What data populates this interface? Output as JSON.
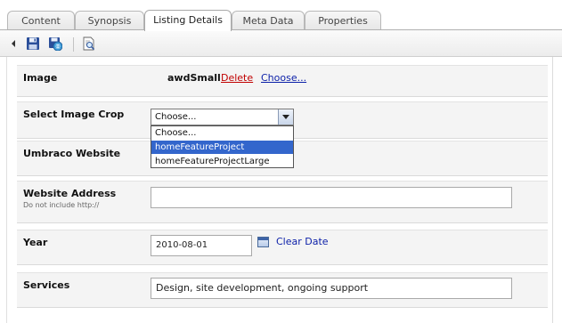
{
  "tabs": [
    {
      "label": "Content",
      "active": false
    },
    {
      "label": "Synopsis",
      "active": false
    },
    {
      "label": "Listing Details",
      "active": true
    },
    {
      "label": "Meta Data",
      "active": false
    },
    {
      "label": "Properties",
      "active": false
    }
  ],
  "toolbar": {
    "icons": [
      "collapse-arrow-icon",
      "save-icon",
      "save-publish-icon",
      "preview-icon"
    ]
  },
  "fields": {
    "image": {
      "label": "Image",
      "filename": "awdSmall",
      "delete_label": "Delete",
      "choose_label": "Choose..."
    },
    "crop": {
      "label": "Select Image Crop",
      "selected": "Choose...",
      "options": [
        "Choose...",
        "homeFeatureProject",
        "homeFeatureProjectLarge"
      ],
      "highlighted": "homeFeatureProject"
    },
    "website": {
      "label": "Umbraco Website"
    },
    "address": {
      "label": "Website Address",
      "hint": "Do not include http://",
      "value": ""
    },
    "year": {
      "label": "Year",
      "value": "2010-08-01",
      "clear_label": "Clear Date"
    },
    "services": {
      "label": "Services",
      "value": "Design, site development, ongoing support"
    }
  },
  "colors": {
    "link": "#0a1ea8",
    "delete": "#c00000",
    "highlight": "#3366cc"
  }
}
